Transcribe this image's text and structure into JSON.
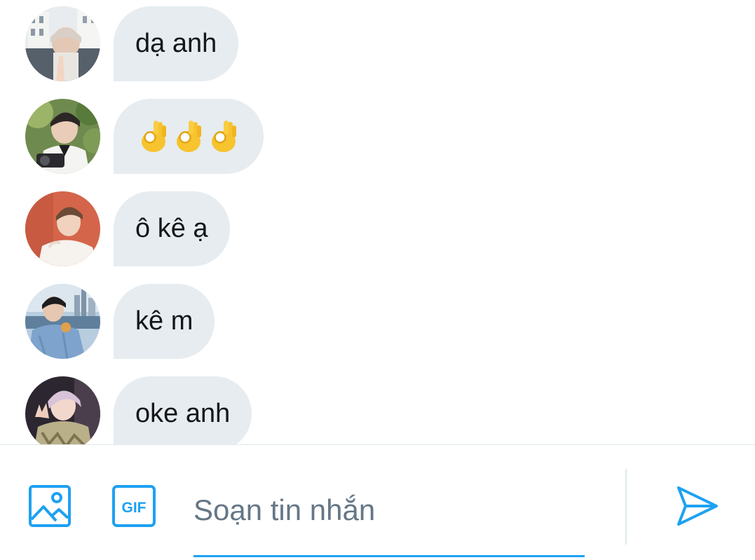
{
  "messages": [
    {
      "text": "dạ anh",
      "avatar": "avatar-building",
      "emoji": false
    },
    {
      "text": "👌👌👌",
      "avatar": "avatar-camera",
      "emoji": true
    },
    {
      "text": "ô kê ạ",
      "avatar": "avatar-red-wall",
      "emoji": false
    },
    {
      "text": "kê m",
      "avatar": "avatar-city",
      "emoji": false
    },
    {
      "text": "oke anh",
      "avatar": "avatar-peace-sign",
      "emoji": false
    }
  ],
  "composer": {
    "image_icon": "image-icon",
    "gif_label": "GIF",
    "placeholder": "Soạn tin nhắn",
    "value": "",
    "send_icon": "send-icon"
  },
  "colors": {
    "accent": "#1da1f2",
    "bubble": "#e6ecf0",
    "text": "#14171a",
    "placeholder": "#657786",
    "border": "#e1e8ed"
  }
}
